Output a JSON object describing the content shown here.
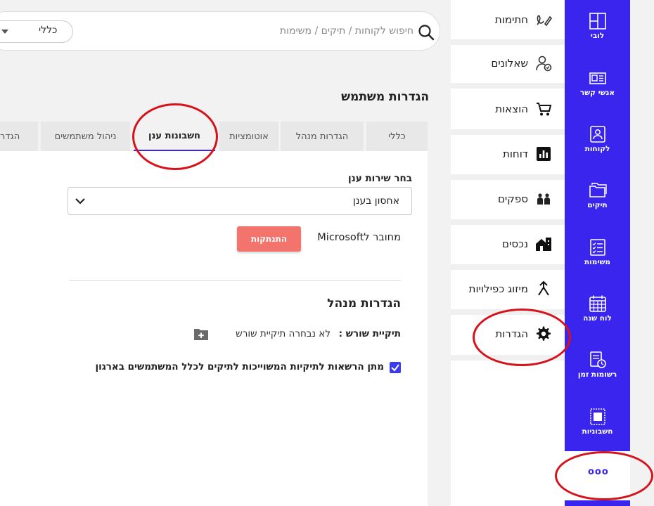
{
  "rail": {
    "items": [
      {
        "label": "לובי",
        "icon": "layout-icon"
      },
      {
        "label": "אנשי קשר",
        "icon": "contact-card-icon"
      },
      {
        "label": "לקוחות",
        "icon": "client-icon"
      },
      {
        "label": "תיקים",
        "icon": "folders-icon"
      },
      {
        "label": "משימות",
        "icon": "tasks-icon"
      },
      {
        "label": "לוח שנה",
        "icon": "calendar-icon"
      },
      {
        "label": "רשומות זמן",
        "icon": "time-records-icon"
      },
      {
        "label": "חשבוניות",
        "icon": "invoice-icon"
      }
    ],
    "more": "ooo"
  },
  "menu": {
    "items": [
      {
        "label": "חתימות",
        "icon": "signature-icon"
      },
      {
        "label": "שאלונים",
        "icon": "questionnaire-icon"
      },
      {
        "label": "הוצאות",
        "icon": "cart-icon"
      },
      {
        "label": "דוחות",
        "icon": "reports-icon"
      },
      {
        "label": "ספקים",
        "icon": "suppliers-icon"
      },
      {
        "label": "נכסים",
        "icon": "assets-icon"
      },
      {
        "label": "מיזוג כפילויות",
        "icon": "merge-icon"
      },
      {
        "label": "הגדרות",
        "icon": "gear-icon"
      }
    ]
  },
  "search": {
    "placeholder": "חיפוש לקוחות / תיקים / משימות",
    "scope": "כללי"
  },
  "page": {
    "title": "הגדרות משתמש",
    "tabs": [
      "כללי",
      "הגדרות מנהל",
      "אוטומציות",
      "חשבונות ענן",
      "ניהול משתמשים",
      "הגדר"
    ]
  },
  "cloud": {
    "service_label": "בחר שירות ענן",
    "service_value": "אחסון בענן",
    "connected_text": "מחובר לMicrosoft",
    "disconnect_label": "התנתקות"
  },
  "admin": {
    "title": "הגדרות מנהל",
    "root_label": "תיקיית שורש :",
    "root_value": "לא נבחרה תיקיית שורש",
    "permission_text": "מתן הרשאות לתיקיות המשוייכות לתיקים לכלל המשתמשים בארגון",
    "permission_checked": true
  },
  "colors": {
    "accent": "#3a25ef",
    "danger": "#f2746c",
    "annotation": "#d6121b"
  }
}
